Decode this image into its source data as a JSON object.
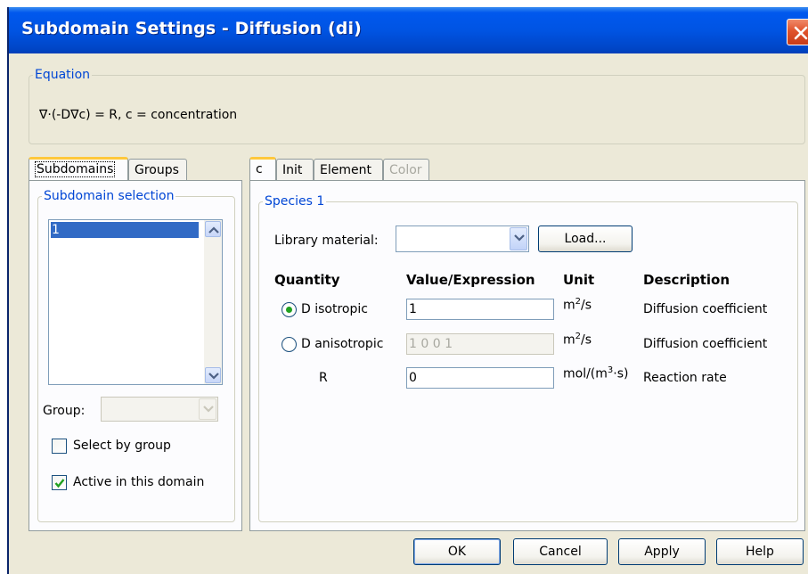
{
  "window": {
    "title": "Subdomain Settings - Diffusion (di)"
  },
  "equation": {
    "legend": "Equation",
    "text": "∇·(-D∇c) = R, c = concentration"
  },
  "left_tabs": [
    {
      "label": "Subdomains",
      "active": true
    },
    {
      "label": "Groups",
      "active": false
    }
  ],
  "subdomain_selection": {
    "legend": "Subdomain selection",
    "items": [
      "1"
    ],
    "selected": "1"
  },
  "group": {
    "label": "Group:",
    "value": ""
  },
  "checkboxes": {
    "select_by_group": {
      "label": "Select by group",
      "checked": false
    },
    "active_in_domain": {
      "label": "Active in this domain",
      "checked": true
    }
  },
  "right_tabs": [
    {
      "label": "c",
      "active": true,
      "enabled": true
    },
    {
      "label": "Init",
      "active": false,
      "enabled": true
    },
    {
      "label": "Element",
      "active": false,
      "enabled": true
    },
    {
      "label": "Color",
      "active": false,
      "enabled": false
    }
  ],
  "species": {
    "legend": "Species 1",
    "library_material_label": "Library material:",
    "library_material_value": "",
    "load_button": "Load...",
    "headers": {
      "quantity": "Quantity",
      "value": "Value/Expression",
      "unit": "Unit",
      "description": "Description"
    },
    "rows": [
      {
        "quantity": "D isotropic",
        "radio": true,
        "selected": true,
        "value": "1",
        "enabled": true,
        "unit_base": "m",
        "unit_sup": "2",
        "unit_tail": "/s",
        "description": "Diffusion coefficient"
      },
      {
        "quantity": "D anisotropic",
        "radio": true,
        "selected": false,
        "value": "1 0 0 1",
        "enabled": false,
        "unit_base": "m",
        "unit_sup": "2",
        "unit_tail": "/s",
        "description": "Diffusion coefficient"
      },
      {
        "quantity": "R",
        "radio": false,
        "selected": false,
        "value": "0",
        "enabled": true,
        "unit_base": "mol/(m",
        "unit_sup": "3",
        "unit_tail": "·s)",
        "description": "Reaction rate"
      }
    ]
  },
  "footer_buttons": {
    "ok": "OK",
    "cancel": "Cancel",
    "apply": "Apply",
    "help": "Help"
  },
  "colors": {
    "title_bar": "#0054e3",
    "dialog_bg": "#ece9d8",
    "legend_text": "#0046d5",
    "selection": "#316ac5",
    "radio_dot": "#21a121",
    "check_mark": "#21a121",
    "close_button": "#e0532c"
  },
  "icons": {
    "close": "close-x-icon",
    "scroll_up": "chevron-up-icon",
    "scroll_down": "chevron-down-icon",
    "combo": "chevron-down-icon",
    "check": "checkmark-icon"
  }
}
